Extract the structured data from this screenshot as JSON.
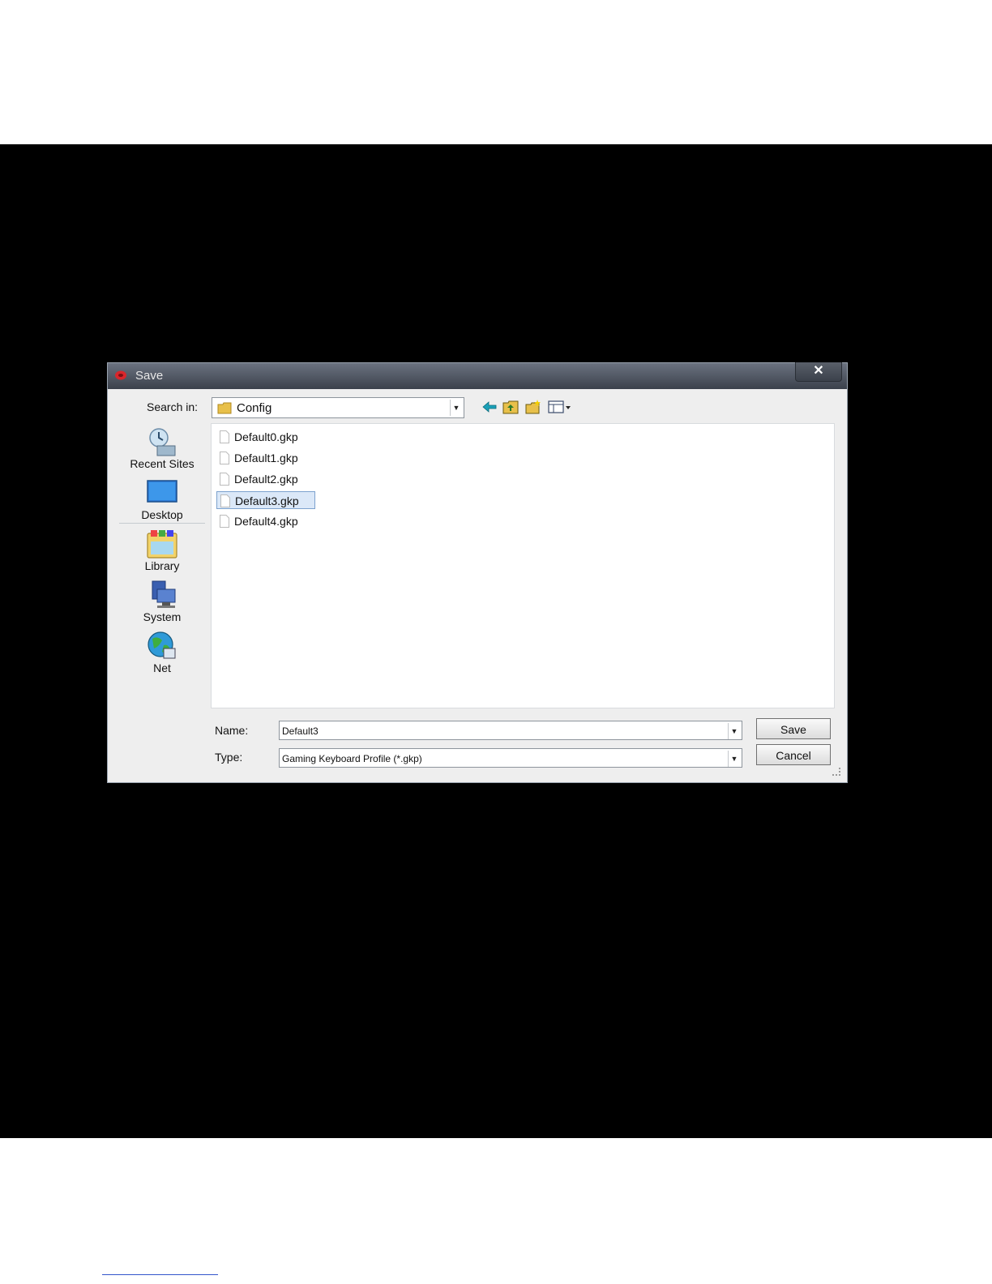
{
  "dialog": {
    "title": "Save",
    "close_glyph": "✕",
    "search_in_label": "Search in:",
    "search_in_value": "Config",
    "toolbar_icons": [
      "back-arrow-icon",
      "up-folder-icon",
      "new-folder-icon",
      "view-menu-icon"
    ]
  },
  "places": [
    {
      "label": "Recent Sites",
      "icon": "recent-sites-icon"
    },
    {
      "label": "Desktop",
      "icon": "desktop-icon"
    },
    {
      "label": "Library",
      "icon": "library-icon"
    },
    {
      "label": "System",
      "icon": "system-icon"
    },
    {
      "label": "Net",
      "icon": "network-icon"
    }
  ],
  "files": [
    {
      "name": "Default0.gkp",
      "selected": false
    },
    {
      "name": "Default1.gkp",
      "selected": false
    },
    {
      "name": "Default2.gkp",
      "selected": false
    },
    {
      "name": "Default3.gkp",
      "selected": true
    },
    {
      "name": "Default4.gkp",
      "selected": false
    }
  ],
  "form": {
    "name_label": "Name:",
    "name_value": "Default3",
    "type_label": "Type:",
    "type_value": "Gaming  Keyboard Profile (*.gkp)",
    "save_label": "Save",
    "cancel_label": "Cancel"
  },
  "colors": {
    "selection": "#dbe8f8",
    "title_icon": "#d9262c",
    "folder": "#e8c04a"
  }
}
